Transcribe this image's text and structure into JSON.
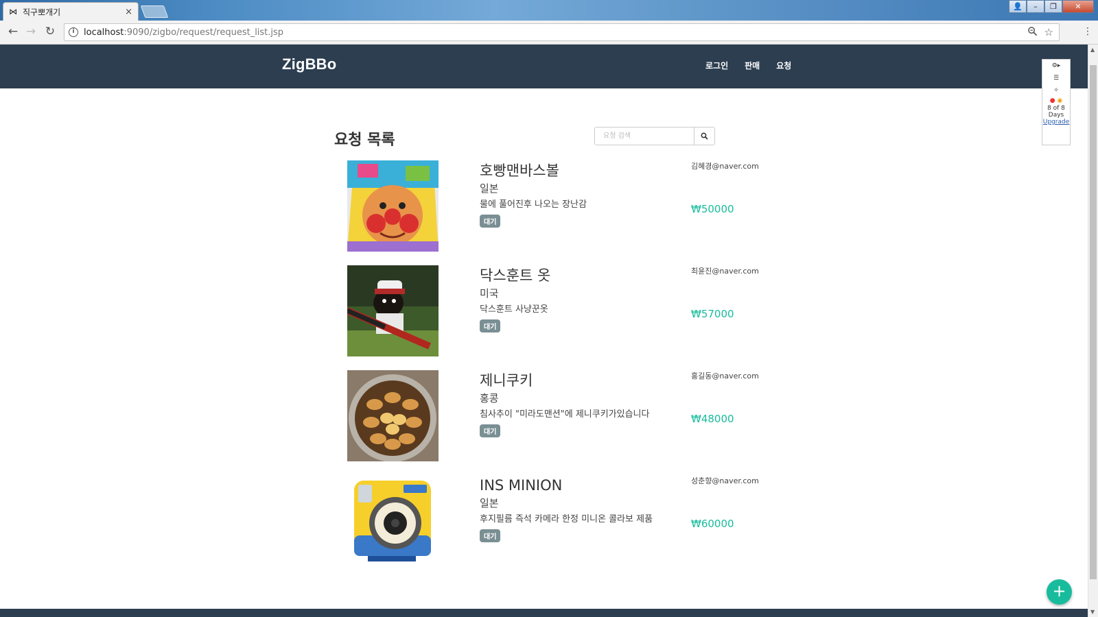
{
  "browser": {
    "tab_title": "직구뽀개기",
    "tab_close": "×",
    "url_host": "localhost",
    "url_path": ":9090/zigbo/request/request_list.jsp"
  },
  "site": {
    "brand": "ZigBBo",
    "menu": [
      "로그인",
      "판매",
      "요청"
    ]
  },
  "extension": {
    "days_line1": "8 of 8",
    "days_line2": "Days",
    "upgrade": "Upgrade"
  },
  "page": {
    "title": "요청 목록",
    "search_placeholder": "요청 검색"
  },
  "requests": [
    {
      "title": "호빵맨바스볼",
      "country": "일본",
      "description": "물에 풀어진후 나오는 장난감",
      "status": "대기",
      "email": "김혜경@naver.com",
      "price": "₩50000",
      "image": "anpanman-candy-package"
    },
    {
      "title": "닥스훈트 옷",
      "country": "미국",
      "description": "닥스훈트 사냥꾼옷",
      "status": "대기",
      "email": "최윤진@naver.com",
      "price": "₩57000",
      "image": "dachshund-hunter-costume"
    },
    {
      "title": "제니쿠키",
      "country": "홍콩",
      "description": "침사추이 \"미라도맨션\"에 제니쿠키가있습니다",
      "status": "대기",
      "email": "홍길동@naver.com",
      "price": "₩48000",
      "image": "jenny-cookies-tin"
    },
    {
      "title": "INS MINION",
      "country": "일본",
      "description": "후지필름 즉석 카메라 한정 미니온 콜라보 제품",
      "status": "대기",
      "email": "성춘향@naver.com",
      "price": "₩60000",
      "image": "minion-instax-camera"
    }
  ],
  "fab_label": "+"
}
